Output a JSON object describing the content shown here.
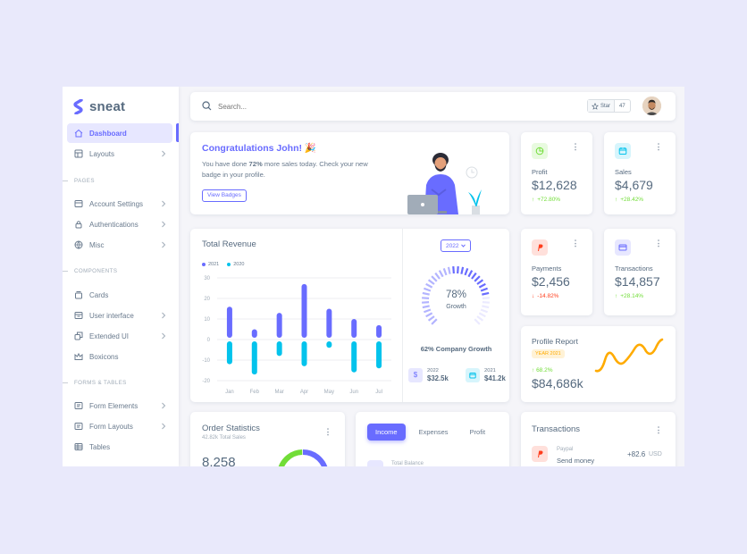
{
  "brand": {
    "name": "sneat",
    "color": "#696cff"
  },
  "sidebar": {
    "dashboard": "Dashboard",
    "layouts": "Layouts",
    "header_pages": "PAGES",
    "account_settings": "Account Settings",
    "authentications": "Authentications",
    "misc": "Misc",
    "header_components": "COMPONENTS",
    "cards": "Cards",
    "user_interface": "User interface",
    "extended_ui": "Extended UI",
    "boxicons": "Boxicons",
    "header_forms": "FORMS & TABLES",
    "form_elements": "Form Elements",
    "form_layouts": "Form Layouts",
    "tables": "Tables"
  },
  "navbar": {
    "search_placeholder": "Search...",
    "star_label": "Star",
    "star_count": "47"
  },
  "congrats": {
    "title": "Congratulations John! 🎉",
    "text_prefix": "You have done ",
    "text_highlight": "72%",
    "text_suffix": " more sales today. Check your new badge in your profile.",
    "button": "View Badges"
  },
  "stats": {
    "profit": {
      "label": "Profit",
      "value": "$12,628",
      "change": "+72.80%",
      "icon": "chart-icon"
    },
    "sales": {
      "label": "Sales",
      "value": "$4,679",
      "change": "+28.42%",
      "icon": "wallet-icon"
    },
    "payments": {
      "label": "Payments",
      "value": "$2,456",
      "change": "-14.82%",
      "icon": "paypal-icon"
    },
    "transactions": {
      "label": "Transactions",
      "value": "$14,857",
      "change": "+28.14%",
      "icon": "credit-card-icon"
    }
  },
  "revenue": {
    "title": "Total Revenue",
    "year_selector": "2022",
    "gauge_percent": "78%",
    "gauge_label": "Growth",
    "gauge_value": 78,
    "company_growth": "62% Company Growth",
    "mini_2022": {
      "year": "2022",
      "value": "$32.5k"
    },
    "mini_2021": {
      "year": "2021",
      "value": "$41.2k"
    }
  },
  "chart_data": {
    "type": "bar",
    "title": "Total Revenue",
    "categories": [
      "Jan",
      "Feb",
      "Mar",
      "Apr",
      "May",
      "Jun",
      "Jul"
    ],
    "series": [
      {
        "name": "2021",
        "values": [
          16,
          5,
          13,
          27,
          15,
          10,
          7
        ],
        "color": "#696cff"
      },
      {
        "name": "2020",
        "values": [
          -12,
          -17,
          -8,
          -13,
          -4,
          -16,
          -14
        ],
        "color": "#03c3ec"
      }
    ],
    "yticks": [
      "30",
      "20",
      "10",
      "0",
      "-10",
      "-20"
    ],
    "ylim": [
      -20,
      30
    ],
    "grid": true,
    "legend_position": "top-left"
  },
  "profile_report": {
    "title": "Profile Report",
    "badge": "YEAR 2021",
    "change": "68.2%",
    "value": "$84,686k"
  },
  "order_stats": {
    "title": "Order Statistics",
    "subtitle": "42.82k Total Sales",
    "value": "8,258"
  },
  "income": {
    "tabs": [
      "Income",
      "Expenses",
      "Profit"
    ],
    "total_balance_label": "Total Balance"
  },
  "transactions_card": {
    "title": "Transactions",
    "method": "Paypal",
    "desc": "Send money",
    "amount": "+82.6",
    "currency": "USD"
  }
}
